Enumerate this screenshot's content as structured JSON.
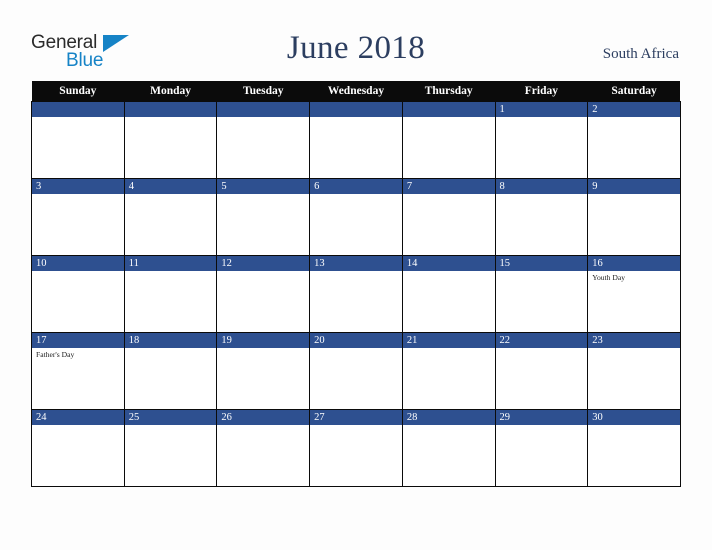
{
  "logo": {
    "word_one": "General",
    "word_two": "Blue",
    "triangle_icon": "triangle-icon",
    "brand_blue": "#1683c6",
    "text_dark": "#2b2b2b"
  },
  "header": {
    "title": "June 2018",
    "country": "South Africa",
    "title_color": "#2c3e60"
  },
  "calendar": {
    "header_background": "#0b0b0b",
    "daybar_background": "#2e5090",
    "cell_background": "#ffffff",
    "border_color": "#0b0b0b",
    "weekdays": [
      "Sunday",
      "Monday",
      "Tuesday",
      "Wednesday",
      "Thursday",
      "Friday",
      "Saturday"
    ],
    "weeks": [
      [
        {
          "date": "",
          "events": []
        },
        {
          "date": "",
          "events": []
        },
        {
          "date": "",
          "events": []
        },
        {
          "date": "",
          "events": []
        },
        {
          "date": "",
          "events": []
        },
        {
          "date": "1",
          "events": []
        },
        {
          "date": "2",
          "events": []
        }
      ],
      [
        {
          "date": "3",
          "events": []
        },
        {
          "date": "4",
          "events": []
        },
        {
          "date": "5",
          "events": []
        },
        {
          "date": "6",
          "events": []
        },
        {
          "date": "7",
          "events": []
        },
        {
          "date": "8",
          "events": []
        },
        {
          "date": "9",
          "events": []
        }
      ],
      [
        {
          "date": "10",
          "events": []
        },
        {
          "date": "11",
          "events": []
        },
        {
          "date": "12",
          "events": []
        },
        {
          "date": "13",
          "events": []
        },
        {
          "date": "14",
          "events": []
        },
        {
          "date": "15",
          "events": []
        },
        {
          "date": "16",
          "events": [
            "Youth Day"
          ]
        }
      ],
      [
        {
          "date": "17",
          "events": [
            "Father's Day"
          ]
        },
        {
          "date": "18",
          "events": []
        },
        {
          "date": "19",
          "events": []
        },
        {
          "date": "20",
          "events": []
        },
        {
          "date": "21",
          "events": []
        },
        {
          "date": "22",
          "events": []
        },
        {
          "date": "23",
          "events": []
        }
      ],
      [
        {
          "date": "24",
          "events": []
        },
        {
          "date": "25",
          "events": []
        },
        {
          "date": "26",
          "events": []
        },
        {
          "date": "27",
          "events": []
        },
        {
          "date": "28",
          "events": []
        },
        {
          "date": "29",
          "events": []
        },
        {
          "date": "30",
          "events": []
        }
      ]
    ]
  }
}
